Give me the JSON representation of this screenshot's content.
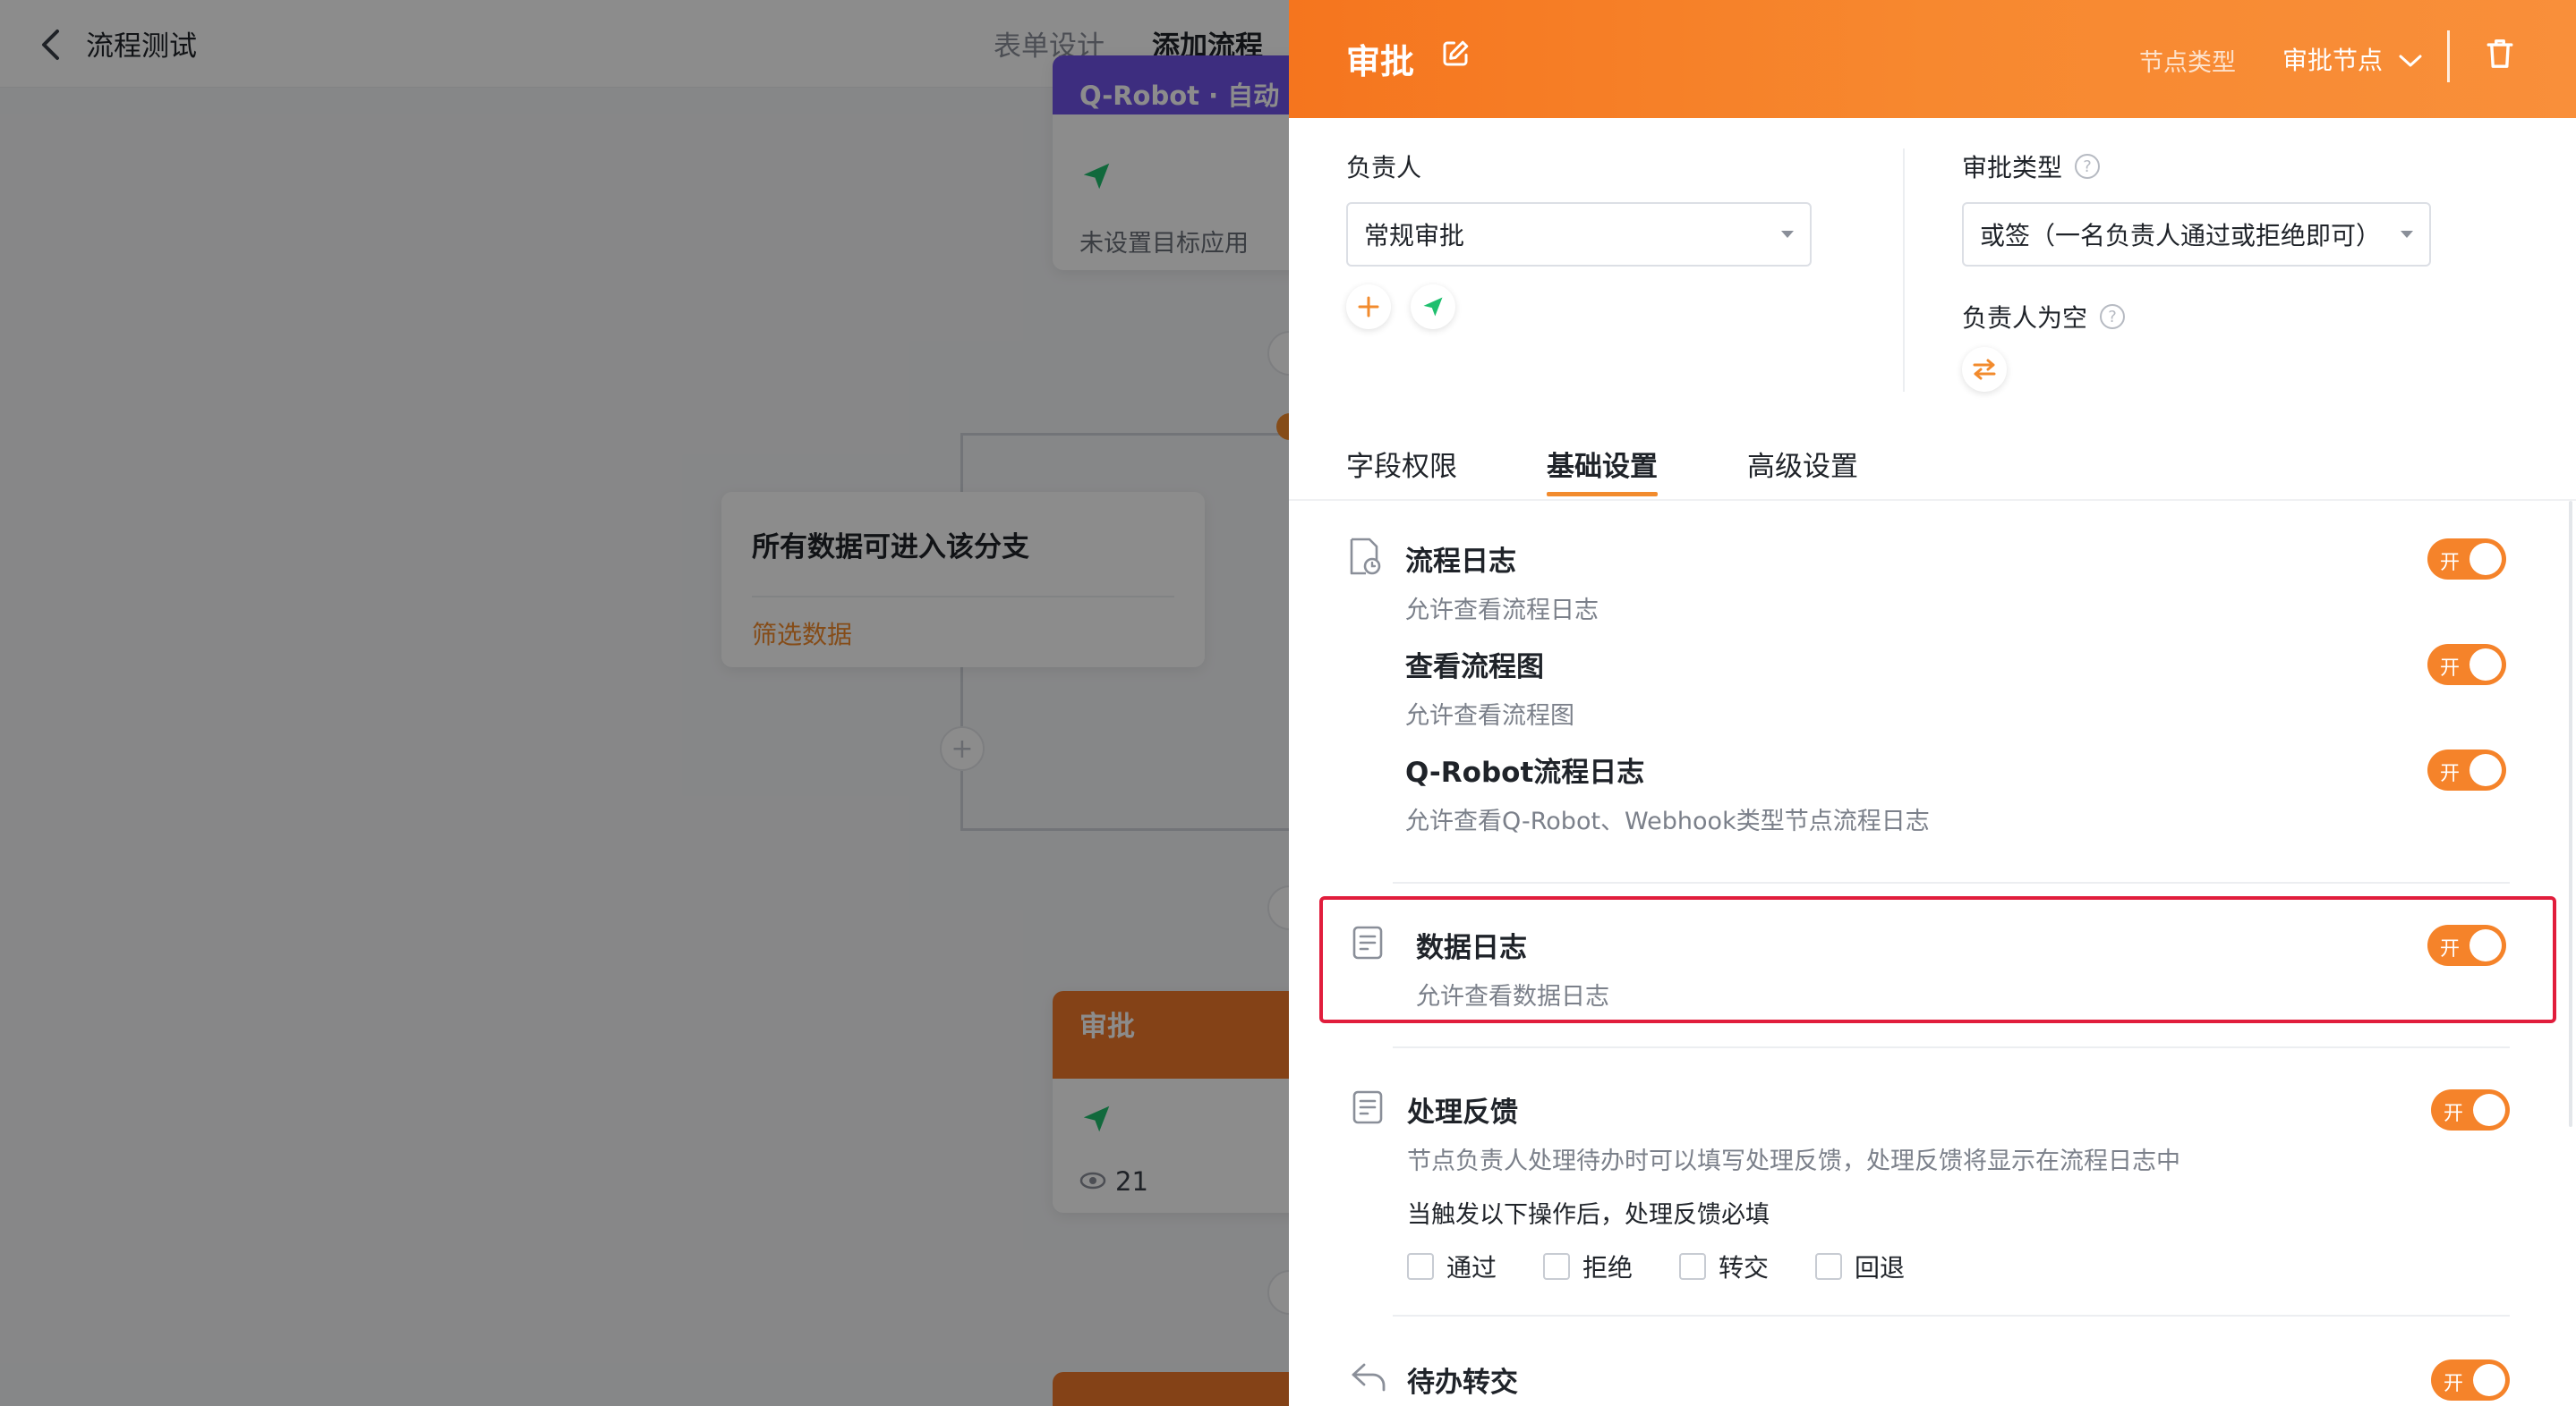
{
  "topbar": {
    "title": "流程测试",
    "tabs": [
      {
        "label": "表单设计",
        "active": false
      },
      {
        "label": "添加流程",
        "active": true
      }
    ]
  },
  "canvas": {
    "robot_node": {
      "title": "Q-Robot · 自动流",
      "status": "未设置目标应用"
    },
    "branch_node": {
      "title": "所有数据可进入该分支",
      "link": "筛选数据"
    },
    "approval_node": {
      "title": "审批",
      "view_count": "21"
    }
  },
  "panel": {
    "title": "审批",
    "node_type_label": "节点类型",
    "node_type_value": "审批节点",
    "owner": {
      "label": "负责人",
      "value": "常规审批"
    },
    "approval_type": {
      "label": "审批类型",
      "value": "或签（一名负责人通过或拒绝即可）"
    },
    "empty_owner": {
      "label": "负责人为空"
    },
    "tabs": [
      {
        "label": "字段权限",
        "active": false
      },
      {
        "label": "基础设置",
        "active": true
      },
      {
        "label": "高级设置",
        "active": false
      }
    ],
    "settings": {
      "flow_log": {
        "title": "流程日志",
        "desc": "允许查看流程日志",
        "toggle": "开"
      },
      "flow_chart": {
        "title": "查看流程图",
        "desc": "允许查看流程图",
        "toggle": "开"
      },
      "robot_log": {
        "title": "Q-Robot流程日志",
        "desc": "允许查看Q-Robot、Webhook类型节点流程日志",
        "toggle": "开"
      },
      "data_log": {
        "title": "数据日志",
        "desc": "允许查看数据日志",
        "toggle": "开"
      },
      "feedback": {
        "title": "处理反馈",
        "desc": "节点负责人处理待办时可以填写处理反馈，处理反馈将显示在流程日志中",
        "toggle": "开",
        "required_label": "当触发以下操作后，处理反馈必填",
        "options": [
          "通过",
          "拒绝",
          "转交",
          "回退"
        ]
      },
      "transfer": {
        "title": "待办转交",
        "toggle": "开"
      }
    }
  },
  "colors": {
    "accent": "#f28b2d",
    "header_start": "#f5751e",
    "toggle_on": "#f5832a",
    "highlight": "#e11d3c",
    "robot_header": "#6f52e8",
    "send_icon": "#1fbf6e"
  }
}
